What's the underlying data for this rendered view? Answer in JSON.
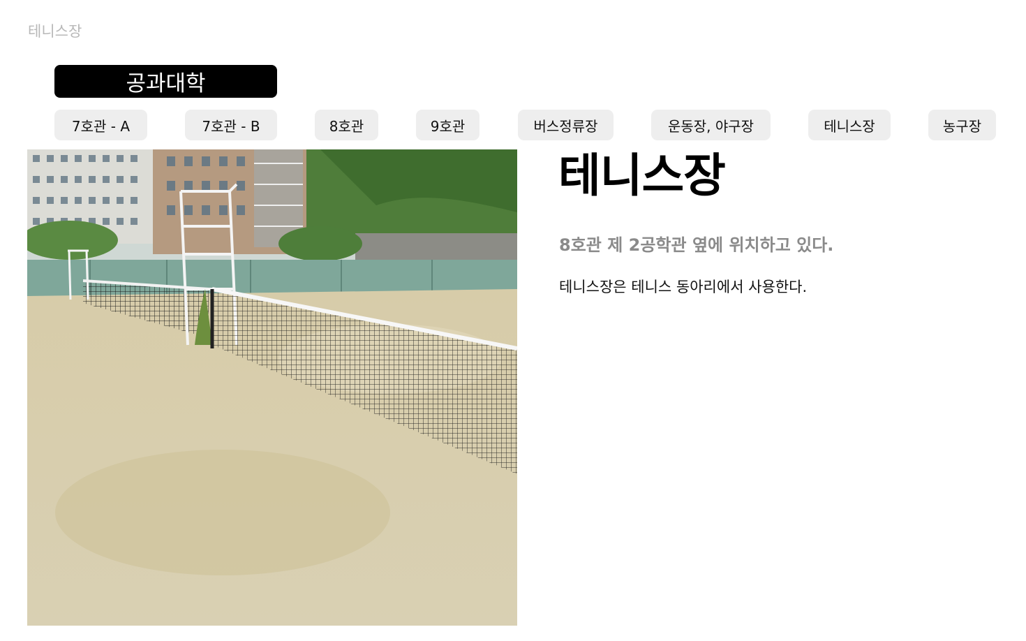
{
  "header": {
    "page_label": "테니스장",
    "category": "공과대학"
  },
  "nav": {
    "tabs": [
      {
        "label": "7호관  - A"
      },
      {
        "label": "7호관  - B"
      },
      {
        "label": "8호관"
      },
      {
        "label": "9호관"
      },
      {
        "label": "버스정류장"
      },
      {
        "label": "운동장, 야구장"
      },
      {
        "label": "테니스장"
      },
      {
        "label": "농구장"
      }
    ]
  },
  "main": {
    "photo_icon": "tennis-court-photo",
    "title": "테니스장",
    "subtitle": "8호관 제 2공학관 옆에 위치하고 있다.",
    "description": "테니스장은 테니스 동아리에서 사용한다."
  },
  "colors": {
    "accent": "#000000",
    "tab_bg": "#eeeeee",
    "muted_text": "#8a8a8a",
    "page_label": "#b8b8b8"
  }
}
